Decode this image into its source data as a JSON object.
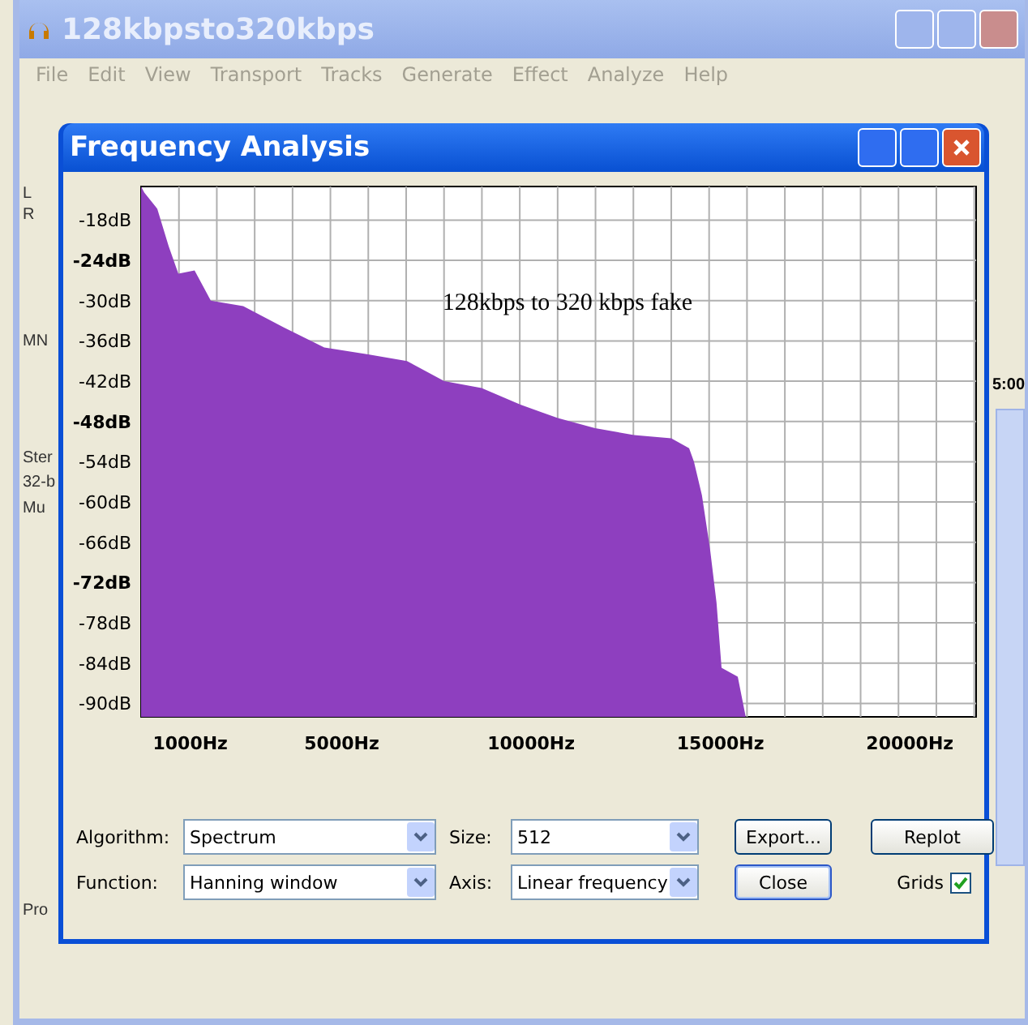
{
  "app_window": {
    "title": "128kbpsto320kbps",
    "menu": [
      "File",
      "Edit",
      "View",
      "Transport",
      "Tracks",
      "Generate",
      "Effect",
      "Analyze",
      "Help"
    ],
    "edge_labels": [
      "L",
      "R",
      "MN",
      "Ster",
      "32-b",
      "Mu",
      "Pro"
    ],
    "time_label": "5:00"
  },
  "dialog": {
    "title": "Frequency Analysis",
    "chart_data": {
      "type": "area",
      "grid": true,
      "xlim": [
        -300,
        21750
      ],
      "ylim": [
        -92,
        -13
      ],
      "xticks": [
        {
          "value": 1000,
          "label": "1000Hz"
        },
        {
          "value": 5000,
          "label": "5000Hz"
        },
        {
          "value": 10000,
          "label": "10000Hz"
        },
        {
          "value": 15000,
          "label": "15000Hz"
        },
        {
          "value": 20000,
          "label": "20000Hz"
        }
      ],
      "yticks": [
        {
          "value": -18,
          "label": "-18dB"
        },
        {
          "value": -24,
          "label": "-24dB"
        },
        {
          "value": -30,
          "label": "-30dB"
        },
        {
          "value": -36,
          "label": "-36dB"
        },
        {
          "value": -42,
          "label": "-42dB"
        },
        {
          "value": -48,
          "label": "-48dB"
        },
        {
          "value": -54,
          "label": "-54dB"
        },
        {
          "value": -60,
          "label": "-60dB"
        },
        {
          "value": -66,
          "label": "-66dB"
        },
        {
          "value": -72,
          "label": "-72dB"
        },
        {
          "value": -78,
          "label": "-78dB"
        },
        {
          "value": -84,
          "label": "-84dB"
        },
        {
          "value": -90,
          "label": "-90dB"
        }
      ],
      "x": [
        -300,
        -214,
        128,
        428,
        685,
        1113,
        1541,
        2397,
        3467,
        4538,
        5693,
        6721,
        7705,
        8690,
        9717,
        10702,
        11687,
        12714,
        13699,
        14170,
        14298,
        14512,
        14726,
        14897,
        15026,
        15454,
        15668
      ],
      "series": [
        {
          "color": "#8e3fbf",
          "values": [
            -13,
            -13.9,
            -16.3,
            -21.9,
            -26,
            -25.5,
            -30,
            -30.8,
            -34,
            -37,
            -38,
            -39,
            -42,
            -43,
            -45.5,
            -47.5,
            -49,
            -50,
            -50.5,
            -52,
            -54,
            -59,
            -67,
            -75,
            -84.7,
            -86,
            -92
          ]
        }
      ],
      "annotations": [
        "128kbps to 320 kbps fake"
      ]
    },
    "fields": [
      {
        "label": "Algorithm:",
        "value": "Spectrum"
      },
      {
        "label": "Size:",
        "value": "512"
      },
      {
        "label": "Function:",
        "value": "Hanning window"
      },
      {
        "label": "Axis:",
        "value": "Linear frequency"
      }
    ],
    "buttons": [
      {
        "label": "Export...",
        "default": false
      },
      {
        "label": "Replot",
        "default": false
      },
      {
        "label": "Close",
        "default": true
      }
    ],
    "grids": {
      "label": "Grids",
      "checked": true
    }
  }
}
